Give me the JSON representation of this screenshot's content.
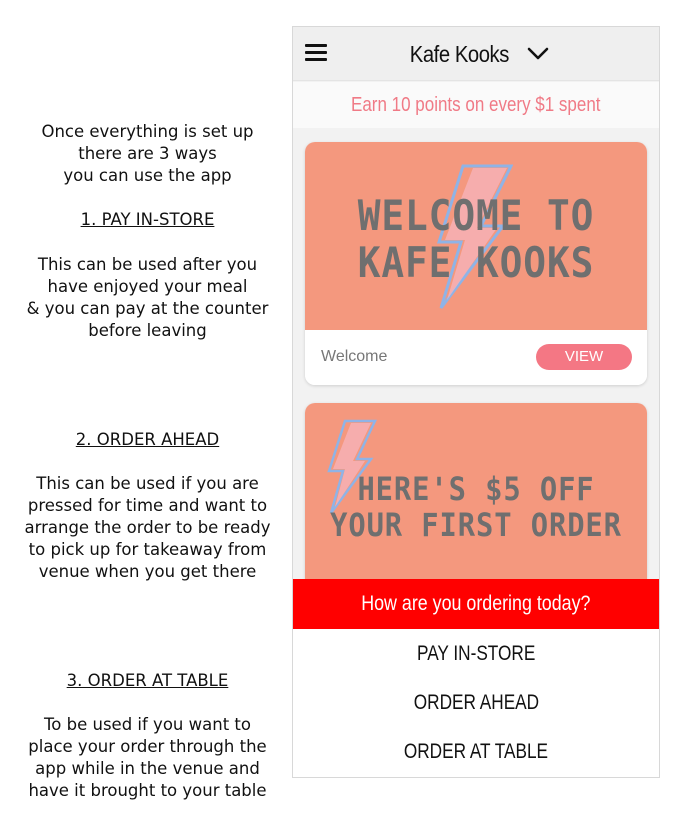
{
  "instructions": {
    "intro": "Once everything is set up\nthere are 3 ways\nyou can use the app",
    "steps": [
      {
        "heading": "1. PAY IN-STORE",
        "body": "This can be used after you\nhave enjoyed your meal\n& you can pay at the counter\nbefore leaving"
      },
      {
        "heading": "2. ORDER AHEAD",
        "body": "This can be used if you are\npressed for time and want to\narrange the order to be ready\nto pick up for takeaway from\nvenue when you get there"
      },
      {
        "heading": "3. ORDER AT TABLE",
        "body": "To be used if you want to\nplace your order through the\napp while in the venue and\nhave it brought to your table"
      }
    ]
  },
  "app": {
    "header": {
      "venue_name": "Kafe Kooks",
      "menu_icon": "hamburger-menu-icon",
      "dropdown_icon": "chevron-down-icon"
    },
    "points_banner": "Earn 10 points on every $1 spent",
    "cards": [
      {
        "image_text": "WELCOME TO\nKAFE KOOKS",
        "label": "Welcome",
        "button": "VIEW"
      },
      {
        "image_text": "HERE'S $5 OFF\nYOUR FIRST ORDER"
      }
    ],
    "order_sheet": {
      "title": "How are you ordering today?",
      "options": [
        "PAY IN-STORE",
        "ORDER AHEAD",
        "ORDER AT TABLE"
      ]
    }
  },
  "colors": {
    "accent_red": "#ff0000",
    "promo_bg": "#f4987e",
    "view_button": "#f47784",
    "points_text": "#f07a86"
  }
}
